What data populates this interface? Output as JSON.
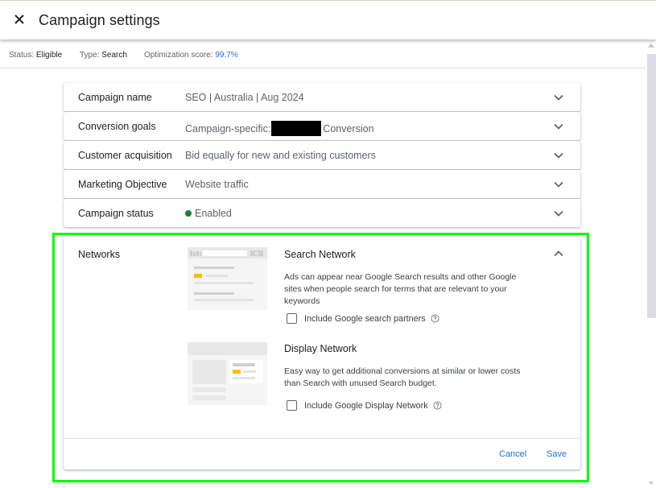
{
  "header": {
    "title": "Campaign settings",
    "close_icon": "close-icon"
  },
  "status_bar": {
    "status_label": "Status:",
    "status_value": "Eligible",
    "type_label": "Type:",
    "type_value": "Search",
    "score_label": "Optimization score:",
    "score_value": "99.7%"
  },
  "settings": [
    {
      "label": "Campaign name",
      "value": "SEO | Australia | Aug 2024"
    },
    {
      "label": "Conversion goals",
      "value_prefix": "Campaign-specific:",
      "value_suffix": "Conversion",
      "redacted": true
    },
    {
      "label": "Customer acquisition",
      "value": "Bid equally for new and existing customers"
    },
    {
      "label": "Marketing Objective",
      "value": "Website traffic"
    },
    {
      "label": "Campaign status",
      "value": "Enabled",
      "status_color": "#188038"
    }
  ],
  "networks": {
    "label": "Networks",
    "search": {
      "title": "Search Network",
      "description": "Ads can appear near Google Search results and other Google sites when people search for terms that are relevant to your keywords",
      "checkbox_label": "Include Google search partners",
      "checked": false
    },
    "display": {
      "title": "Display Network",
      "description": "Easy way to get additional conversions at similar or lower costs than Search with unused Search budget.",
      "checkbox_label": "Include Google Display Network",
      "checked": false
    },
    "cancel_label": "Cancel",
    "save_label": "Save"
  },
  "colors": {
    "accent": "#1a73e8",
    "highlight": "#00ff00",
    "enabled": "#188038",
    "illustration_ad": "#fbbc04"
  }
}
